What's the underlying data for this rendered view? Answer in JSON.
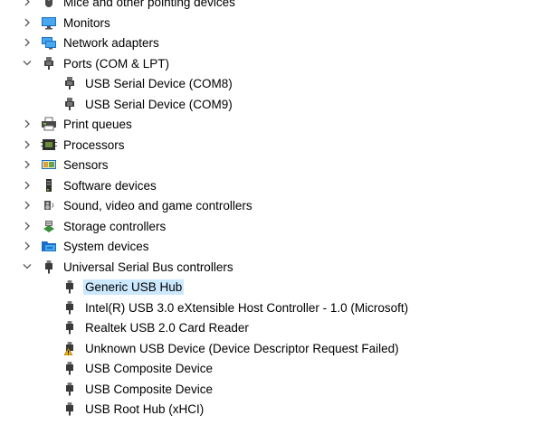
{
  "tree": [
    {
      "label": "Mice and other pointing devices",
      "icon": "mouse-icon",
      "level": 0,
      "expanded": false
    },
    {
      "label": "Monitors",
      "icon": "monitor-icon",
      "level": 0,
      "expanded": false
    },
    {
      "label": "Network adapters",
      "icon": "network-adapter-icon",
      "level": 0,
      "expanded": false
    },
    {
      "label": "Ports (COM & LPT)",
      "icon": "port-icon",
      "level": 0,
      "expanded": true
    },
    {
      "label": "USB Serial Device (COM8)",
      "icon": "port-icon",
      "level": 1
    },
    {
      "label": "USB Serial Device (COM9)",
      "icon": "port-icon",
      "level": 1
    },
    {
      "label": "Print queues",
      "icon": "printer-icon",
      "level": 0,
      "expanded": false
    },
    {
      "label": "Processors",
      "icon": "processor-icon",
      "level": 0,
      "expanded": false
    },
    {
      "label": "Sensors",
      "icon": "sensor-icon",
      "level": 0,
      "expanded": false
    },
    {
      "label": "Software devices",
      "icon": "software-device-icon",
      "level": 0,
      "expanded": false
    },
    {
      "label": "Sound, video and game controllers",
      "icon": "speaker-icon",
      "level": 0,
      "expanded": false
    },
    {
      "label": "Storage controllers",
      "icon": "storage-controller-icon",
      "level": 0,
      "expanded": false
    },
    {
      "label": "System devices",
      "icon": "system-folder-icon",
      "level": 0,
      "expanded": false
    },
    {
      "label": "Universal Serial Bus controllers",
      "icon": "usb-plug-icon",
      "level": 0,
      "expanded": true
    },
    {
      "label": "Generic USB Hub",
      "icon": "usb-plug-icon",
      "level": 1,
      "selected": true
    },
    {
      "label": "Intel(R) USB 3.0 eXtensible Host Controller - 1.0 (Microsoft)",
      "icon": "usb-plug-icon",
      "level": 1
    },
    {
      "label": "Realtek USB 2.0 Card Reader",
      "icon": "usb-plug-icon",
      "level": 1
    },
    {
      "label": "Unknown USB Device (Device Descriptor Request Failed)",
      "icon": "usb-warning-icon",
      "level": 1
    },
    {
      "label": "USB Composite Device",
      "icon": "usb-plug-icon",
      "level": 1
    },
    {
      "label": "USB Composite Device",
      "icon": "usb-plug-icon",
      "level": 1
    },
    {
      "label": "USB Root Hub (xHCI)",
      "icon": "usb-plug-icon",
      "level": 1
    }
  ],
  "colors": {
    "selection": "#cce8ff",
    "chevron": "#5a5a5a",
    "warning": "#f2b600"
  }
}
